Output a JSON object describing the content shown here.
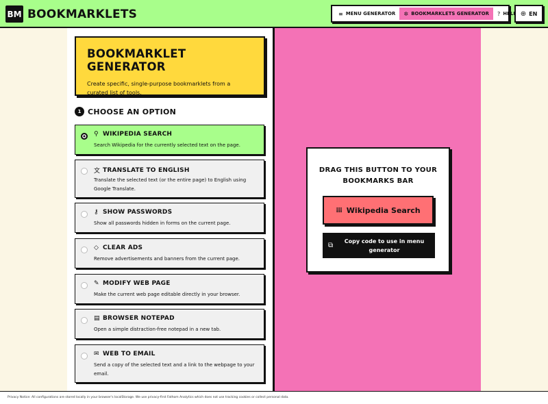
{
  "header": {
    "logo_badge": "BM",
    "logo_text": "BOOKMARKLETS",
    "nav": [
      {
        "icon": "menu-icon",
        "glyph": "≡",
        "label": "MENU GENERATOR",
        "active": false
      },
      {
        "icon": "puzzle-icon",
        "glyph": "✲",
        "label": "BOOKMARKLETS GENERATOR",
        "active": true
      },
      {
        "icon": "help-icon",
        "glyph": "?",
        "label": "HELP",
        "active": false
      }
    ],
    "language": "EN"
  },
  "hero": {
    "title": "BOOKMARKLET GENERATOR",
    "description": "Create specific, single-purpose bookmarklets from a curated list of tools."
  },
  "step": {
    "number": "1",
    "label": "CHOOSE AN OPTION"
  },
  "options": [
    {
      "icon": "search-icon",
      "glyph": "⚲",
      "title": "WIKIPEDIA SEARCH",
      "description": "Search Wikipedia for the currently selected text on the page.",
      "selected": true
    },
    {
      "icon": "translate-icon",
      "glyph": "文",
      "title": "TRANSLATE TO ENGLISH",
      "description": "Translate the selected text (or the entire page) to English using Google Translate.",
      "selected": false
    },
    {
      "icon": "key-icon",
      "glyph": "⚷",
      "title": "SHOW PASSWORDS",
      "description": "Show all passwords hidden in forms on the current page.",
      "selected": false
    },
    {
      "icon": "eraser-icon",
      "glyph": "◇",
      "title": "CLEAR ADS",
      "description": "Remove advertisements and banners from the current page.",
      "selected": false
    },
    {
      "icon": "pencil-icon",
      "glyph": "✎",
      "title": "MODIFY WEB PAGE",
      "description": "Make the current web page editable directly in your browser.",
      "selected": false
    },
    {
      "icon": "notepad-icon",
      "glyph": "▤",
      "title": "BROWSER NOTEPAD",
      "description": "Open a simple distraction-free notepad in a new tab.",
      "selected": false
    },
    {
      "icon": "mail-icon",
      "glyph": "✉",
      "title": "WEB TO EMAIL",
      "description": "Send a copy of the selected text and a link to the webpage to your email.",
      "selected": false
    }
  ],
  "drag_card": {
    "title": "DRAG THIS BUTTON TO YOUR BOOKMARKS BAR",
    "bookmarklet_label": "Wikipedia Search",
    "copy_label": "Copy code to use in menu generator"
  },
  "footer": {
    "notice": "Privacy Notice: All configurations are stored locally in your browser's localStorage. We use privacy-first Fathom Analytics which does not use tracking cookies or collect personal data."
  }
}
